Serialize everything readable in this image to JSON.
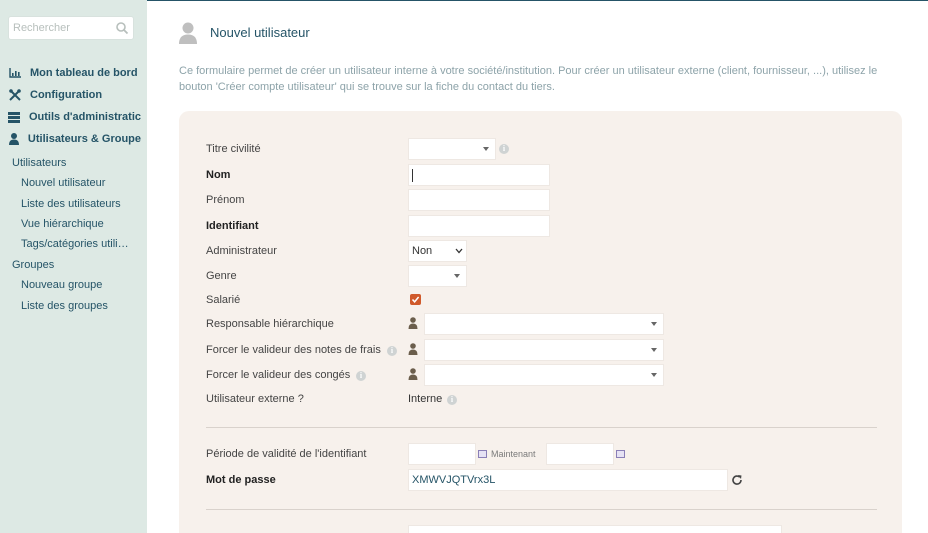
{
  "sidebar": {
    "search_placeholder": "Rechercher",
    "menu": [
      {
        "label": "Mon tableau de bord",
        "icon": "chart-icon"
      },
      {
        "label": "Configuration",
        "icon": "tools-icon"
      },
      {
        "label": "Outils d'administratic",
        "icon": "server-icon"
      },
      {
        "label": "Utilisateurs & Groupe",
        "icon": "user-icon"
      }
    ],
    "sub": [
      {
        "label": "Utilisateurs"
      },
      {
        "label": "Nouvel utilisateur"
      },
      {
        "label": "Liste des utilisateurs"
      },
      {
        "label": "Vue hiérarchique"
      },
      {
        "label": "Tags/catégories utili…"
      },
      {
        "label": "Groupes"
      },
      {
        "label": "Nouveau groupe"
      },
      {
        "label": "Liste des groupes"
      }
    ]
  },
  "page": {
    "title": "Nouvel utilisateur",
    "intro": "Ce formulaire permet de créer un utilisateur interne à votre société/institution. Pour créer un utilisateur externe (client, fournisseur, ...), utilisez le bouton 'Créer compte utilisateur' qui se trouve sur la fiche du contact du tiers."
  },
  "form": {
    "titre_civilite": "Titre civilité",
    "nom": "Nom",
    "prenom": "Prénom",
    "identifiant": "Identifiant",
    "administrateur": "Administrateur",
    "administrateur_value": "Non",
    "genre": "Genre",
    "salarie": "Salarié",
    "salarie_checked": true,
    "responsable": "Responsable hiérarchique",
    "valideur_frais": "Forcer le valideur des notes de frais",
    "valideur_conges": "Forcer le valideur des congés",
    "externe": "Utilisateur externe ?",
    "externe_value": "Interne",
    "periode": "Période de validité de l'identifiant",
    "maintenant": "Maintenant",
    "mot_de_passe": "Mot de passe",
    "mot_de_passe_value": "XMWVJQTVrx3L"
  },
  "colors": {
    "sidebar_bg": "#dde9e4",
    "link": "#255467",
    "card_bg": "#f7f1ec",
    "checkbox": "#d05a2b"
  }
}
